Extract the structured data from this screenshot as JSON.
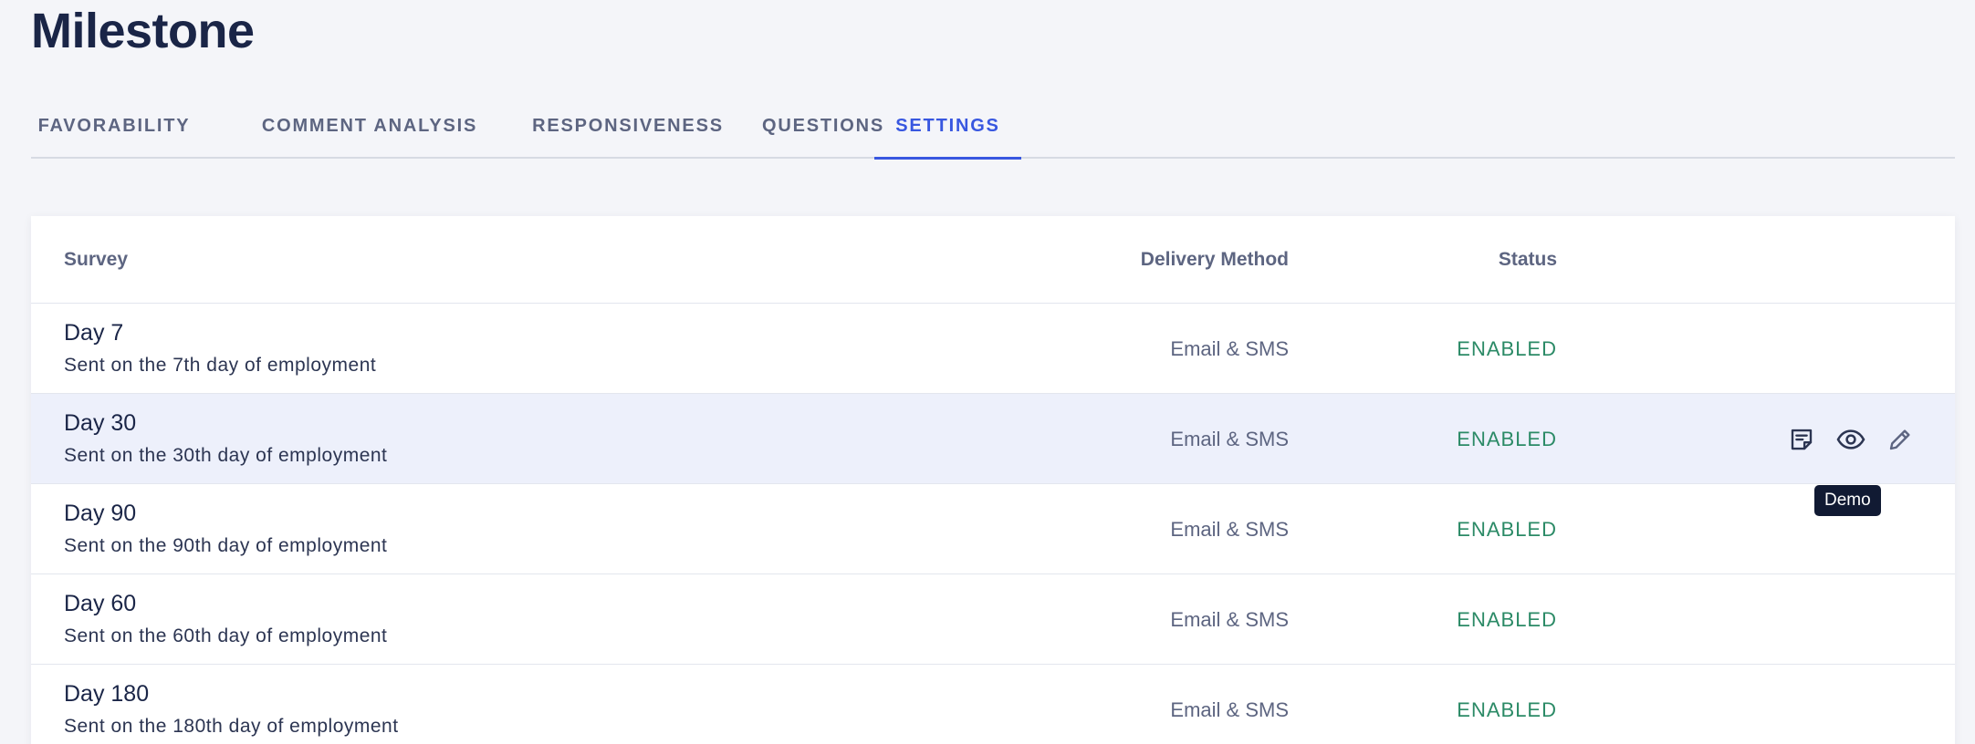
{
  "page": {
    "title": "Milestone"
  },
  "tabs": [
    {
      "label": "FAVORABILITY",
      "active": false
    },
    {
      "label": "COMMENT ANALYSIS",
      "active": false
    },
    {
      "label": "RESPONSIVENESS",
      "active": false
    },
    {
      "label": "QUESTIONS",
      "active": false
    },
    {
      "label": "SETTINGS",
      "active": true
    }
  ],
  "table": {
    "headers": {
      "survey": "Survey",
      "delivery": "Delivery Method",
      "status": "Status"
    },
    "rows": [
      {
        "title": "Day 7",
        "subtitle": "Sent on the 7th day of employment",
        "delivery": "Email & SMS",
        "status": "ENABLED"
      },
      {
        "title": "Day 30",
        "subtitle": "Sent on the 30th day of employment",
        "delivery": "Email & SMS",
        "status": "ENABLED"
      },
      {
        "title": "Day 90",
        "subtitle": "Sent on the 90th day of employment",
        "delivery": "Email & SMS",
        "status": "ENABLED"
      },
      {
        "title": "Day 60",
        "subtitle": "Sent on the 60th day of employment",
        "delivery": "Email & SMS",
        "status": "ENABLED"
      },
      {
        "title": "Day 180",
        "subtitle": "Sent on the 180th day of employment",
        "delivery": "Email & SMS",
        "status": "ENABLED"
      }
    ]
  },
  "row_actions": {
    "icons": [
      "notes-icon",
      "eye-icon",
      "pencil-icon"
    ],
    "tooltip": "Demo"
  },
  "colors": {
    "accent": "#3857e0",
    "status_enabled": "#2b8a66",
    "title": "#1a2547",
    "muted": "#5d6581",
    "hover_row": "#edf0fb"
  }
}
